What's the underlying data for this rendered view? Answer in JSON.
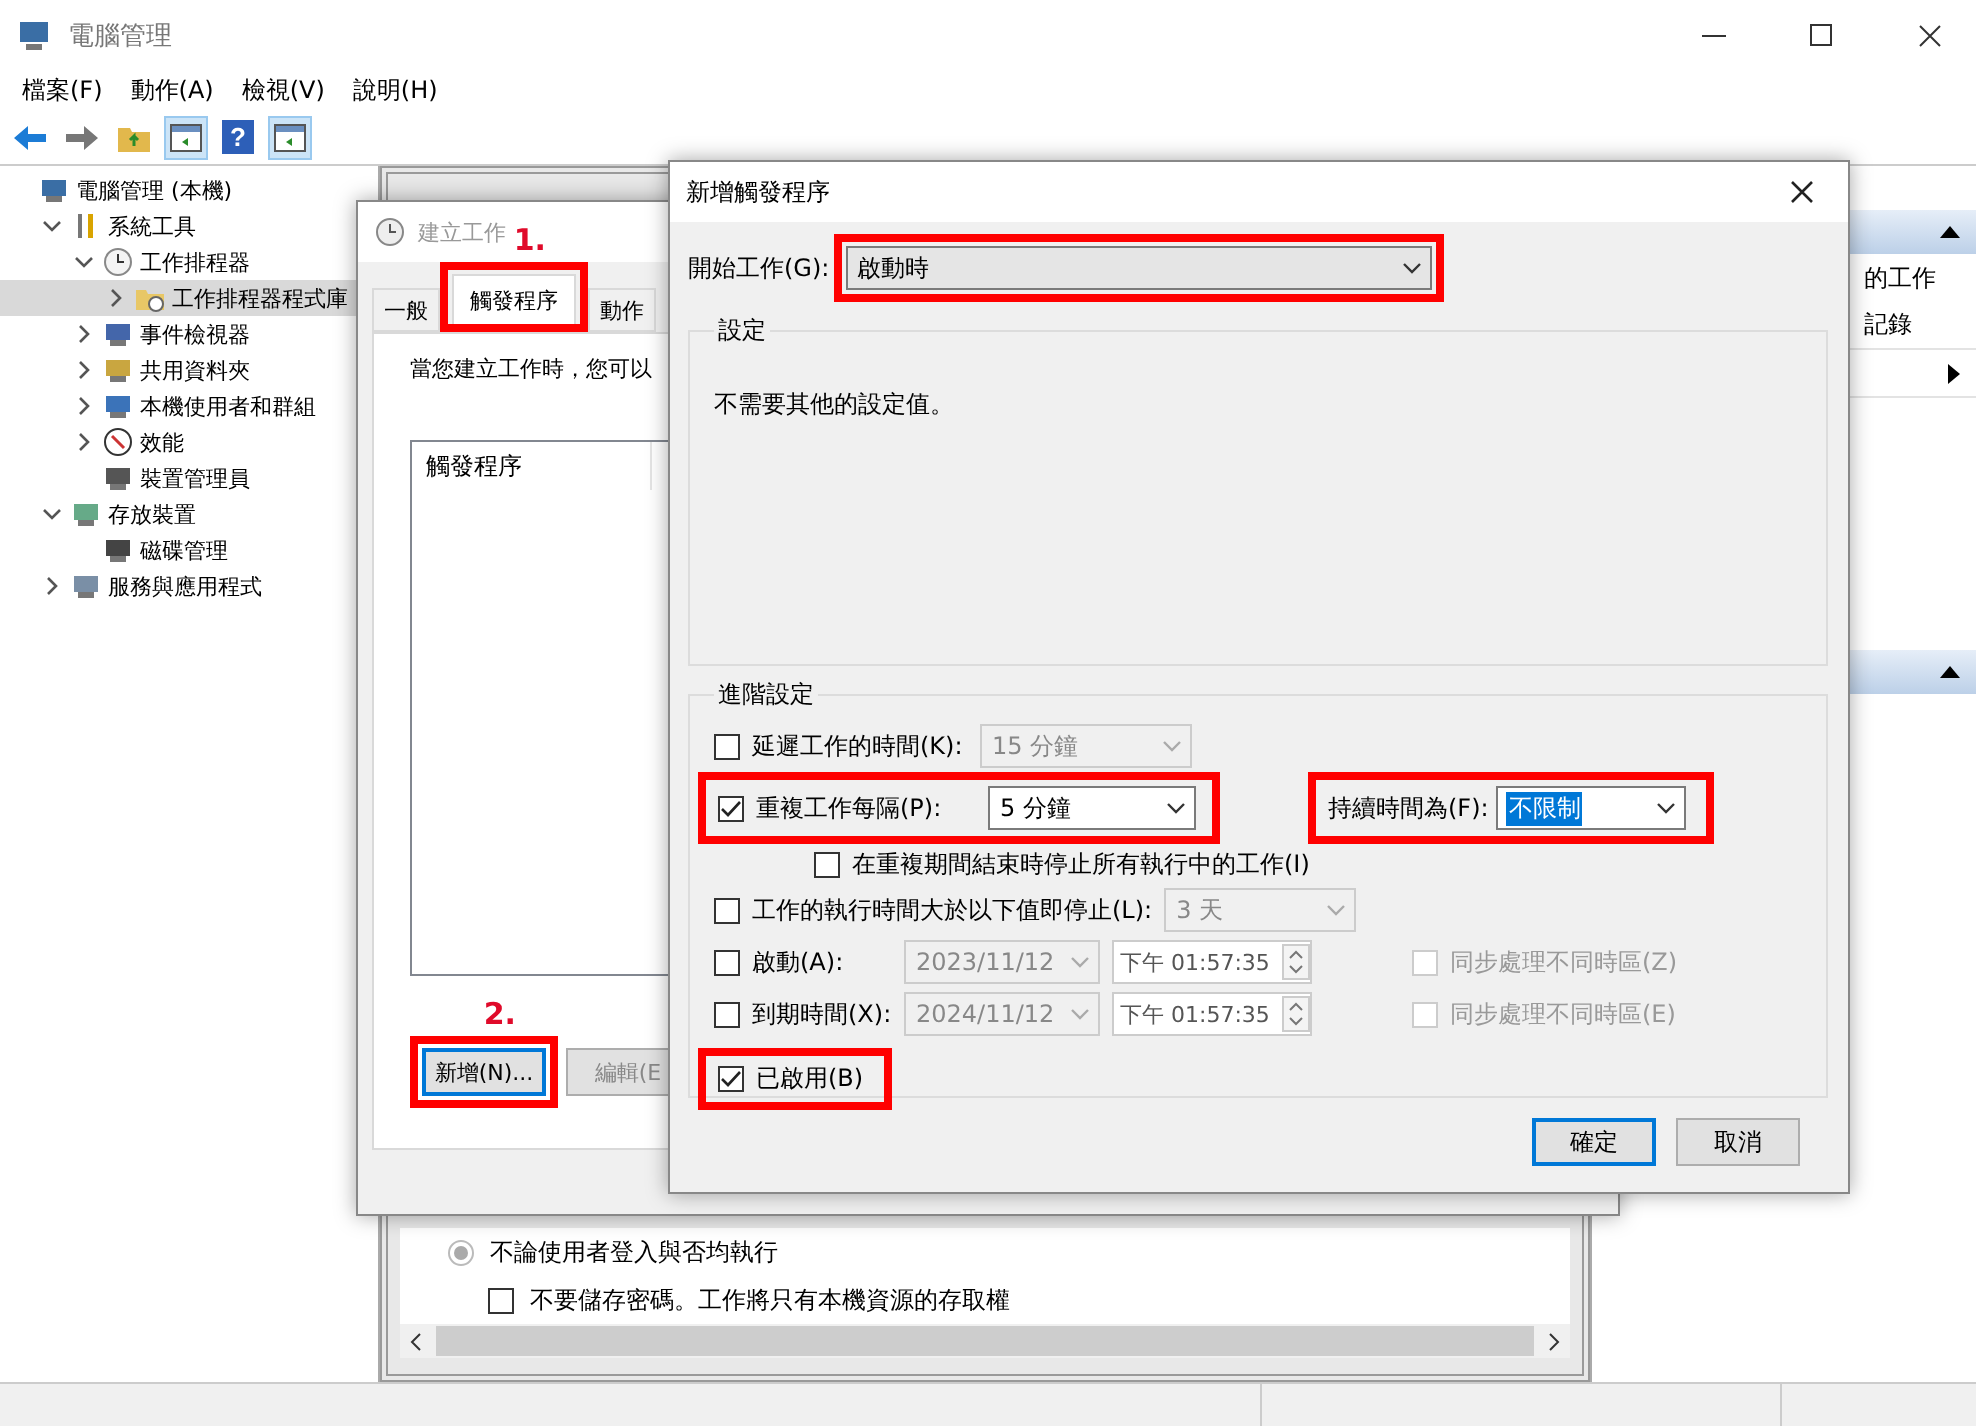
{
  "window": {
    "title": "電腦管理",
    "menu": [
      "檔案(F)",
      "動作(A)",
      "檢視(V)",
      "說明(H)"
    ],
    "toolbar": [
      {
        "kind": "back",
        "selected": false
      },
      {
        "kind": "forward",
        "selected": false
      },
      {
        "kind": "up",
        "selected": false
      },
      {
        "kind": "pane",
        "selected": true
      },
      {
        "kind": "help",
        "glyph": "?",
        "selected": false
      },
      {
        "kind": "pane",
        "selected": true
      }
    ]
  },
  "tree": [
    {
      "label": "電腦管理 (本機)",
      "kind": "computer",
      "selected": false,
      "children": [
        {
          "label": "系統工具",
          "kind": "tools",
          "expanded": true,
          "selected": false,
          "children": [
            {
              "label": "工作排程器",
              "kind": "clock",
              "expanded": true,
              "selected": false,
              "children": [
                {
                  "label": "工作排程器程式庫",
                  "kind": "folder",
                  "expanded": false,
                  "selected": true
                }
              ]
            },
            {
              "label": "事件檢視器",
              "kind": "event",
              "expanded": false,
              "selected": false
            },
            {
              "label": "共用資料夾",
              "kind": "share",
              "expanded": false,
              "selected": false
            },
            {
              "label": "本機使用者和群組",
              "kind": "users",
              "expanded": false,
              "selected": false
            },
            {
              "label": "效能",
              "kind": "perf",
              "expanded": false,
              "selected": false
            },
            {
              "label": "裝置管理員",
              "kind": "device",
              "selected": false
            }
          ]
        },
        {
          "label": "存放裝置",
          "kind": "storage",
          "expanded": true,
          "selected": false,
          "children": [
            {
              "label": "磁碟管理",
              "kind": "disk",
              "selected": false
            }
          ]
        },
        {
          "label": "服務與應用程式",
          "kind": "services",
          "expanded": false,
          "selected": false
        }
      ]
    }
  ],
  "center_pane": {
    "options": [
      {
        "kind": "radio",
        "label": "不論使用者登入與否均執行",
        "selected": true,
        "disabled": true
      },
      {
        "kind": "checkbox",
        "label": "不要儲存密碼。工作將只有本機資源的存取權",
        "checked": false
      }
    ]
  },
  "right_pane": {
    "sections": [
      {
        "expanded": true,
        "items": [
          {
            "kind": "text",
            "label": "的工作"
          },
          {
            "kind": "text",
            "label": "記錄"
          },
          {
            "kind": "submenu"
          }
        ]
      },
      {
        "expanded": true
      }
    ]
  },
  "create_task": {
    "title": "建立工作",
    "tabs": [
      {
        "label": "一般",
        "selected": false
      },
      {
        "label": "觸發程序",
        "selected": true,
        "highlighted": true,
        "annotation": "1."
      },
      {
        "label": "動作",
        "selected": false
      }
    ],
    "intro": "當您建立工作時，您可以",
    "list": {
      "columns": [
        "觸發程序"
      ]
    },
    "buttons": [
      {
        "label": "新增(N)...",
        "focused": true,
        "disabled": false,
        "highlighted": true,
        "annotation": "2."
      },
      {
        "label": "編輯(E",
        "focused": false,
        "disabled": true
      }
    ]
  },
  "new_trigger": {
    "title": "新增觸發程序",
    "begin": {
      "label": "開始工作(G):",
      "value": "啟動時",
      "highlighted": true
    },
    "settings": {
      "legend": "設定",
      "text": "不需要其他的設定值。"
    },
    "advanced": {
      "legend": "進階設定",
      "rows": [
        {
          "kind": "select",
          "checked": false,
          "label": "延遲工作的時間(K):",
          "value": "15 分鐘",
          "disabled": true
        },
        {
          "kind": "repeat",
          "checked": true,
          "label": "重複工作每隔(P):",
          "value": "5 分鐘",
          "disabled": false,
          "highlighted": true,
          "duration": {
            "label": "持續時間為(F):",
            "value": "不限制",
            "text_selected": true,
            "highlighted": true
          }
        },
        {
          "kind": "sub",
          "checked": false,
          "label": "在重複期間結束時停止所有執行中的工作(I)"
        },
        {
          "kind": "select",
          "checked": false,
          "label": "工作的執行時間大於以下值即停止(L):",
          "value": "3 天",
          "disabled": true
        },
        {
          "kind": "date",
          "checked": false,
          "label": "啟動(A):",
          "date": "2023/11/12",
          "time": "下午 01:57:35",
          "sync": {
            "label": "同步處理不同時區(Z)",
            "checked": false
          }
        },
        {
          "kind": "date",
          "checked": false,
          "label": "到期時間(X):",
          "date": "2024/11/12",
          "time": "下午 01:57:35",
          "sync": {
            "label": "同步處理不同時區(E)",
            "checked": false
          }
        }
      ],
      "enabled": {
        "label": "已啟用(B)",
        "checked": true,
        "highlighted": true
      }
    },
    "buttons": [
      {
        "label": "確定",
        "default": true
      },
      {
        "label": "取消",
        "default": false
      }
    ]
  }
}
